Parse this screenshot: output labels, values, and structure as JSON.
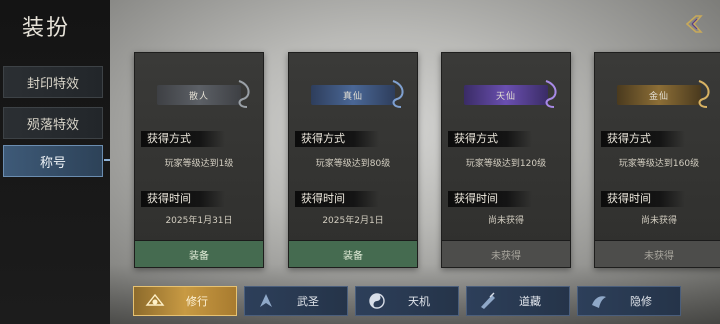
{
  "sidebar": {
    "title": "装扮",
    "tabs": [
      {
        "label": "封印特效",
        "active": false
      },
      {
        "label": "殒落特效",
        "active": false
      },
      {
        "label": "称号",
        "active": true
      }
    ]
  },
  "cards": [
    {
      "name": "散人",
      "tier_color": "#8a8f94",
      "method_label": "获得方式",
      "method": "玩家等级达到1级",
      "time_label": "获得时间",
      "time": "2025年1月31日",
      "button": "装备",
      "button_state": "equip"
    },
    {
      "name": "真仙",
      "tier_color": "#5d7fb3",
      "method_label": "获得方式",
      "method": "玩家等级达到80级",
      "time_label": "获得时间",
      "time": "2025年2月1日",
      "button": "装备",
      "button_state": "equip"
    },
    {
      "name": "天仙",
      "tier_color": "#7b5fc4",
      "method_label": "获得方式",
      "method": "玩家等级达到120级",
      "time_label": "获得时间",
      "time": "尚未获得",
      "button": "未获得",
      "button_state": "locked"
    },
    {
      "name": "金仙",
      "tier_color": "#c9a14a",
      "method_label": "获得方式",
      "method": "玩家等级达到160级",
      "time_label": "获得时间",
      "time": "尚未获得",
      "button": "未获得",
      "button_state": "locked"
    }
  ],
  "bottom_tabs": [
    {
      "label": "修行",
      "icon": "cultivation-icon",
      "active": true
    },
    {
      "label": "武圣",
      "icon": "martial-saint-icon",
      "active": false
    },
    {
      "label": "天机",
      "icon": "yin-yang-icon",
      "active": false
    },
    {
      "label": "道藏",
      "icon": "scripture-icon",
      "active": false
    },
    {
      "label": "隐修",
      "icon": "recluse-icon",
      "active": false
    }
  ],
  "accent_colors": {
    "active_tab": "#c89a43",
    "equip": "#456b50",
    "sidebar_active": "#3e5a78"
  }
}
